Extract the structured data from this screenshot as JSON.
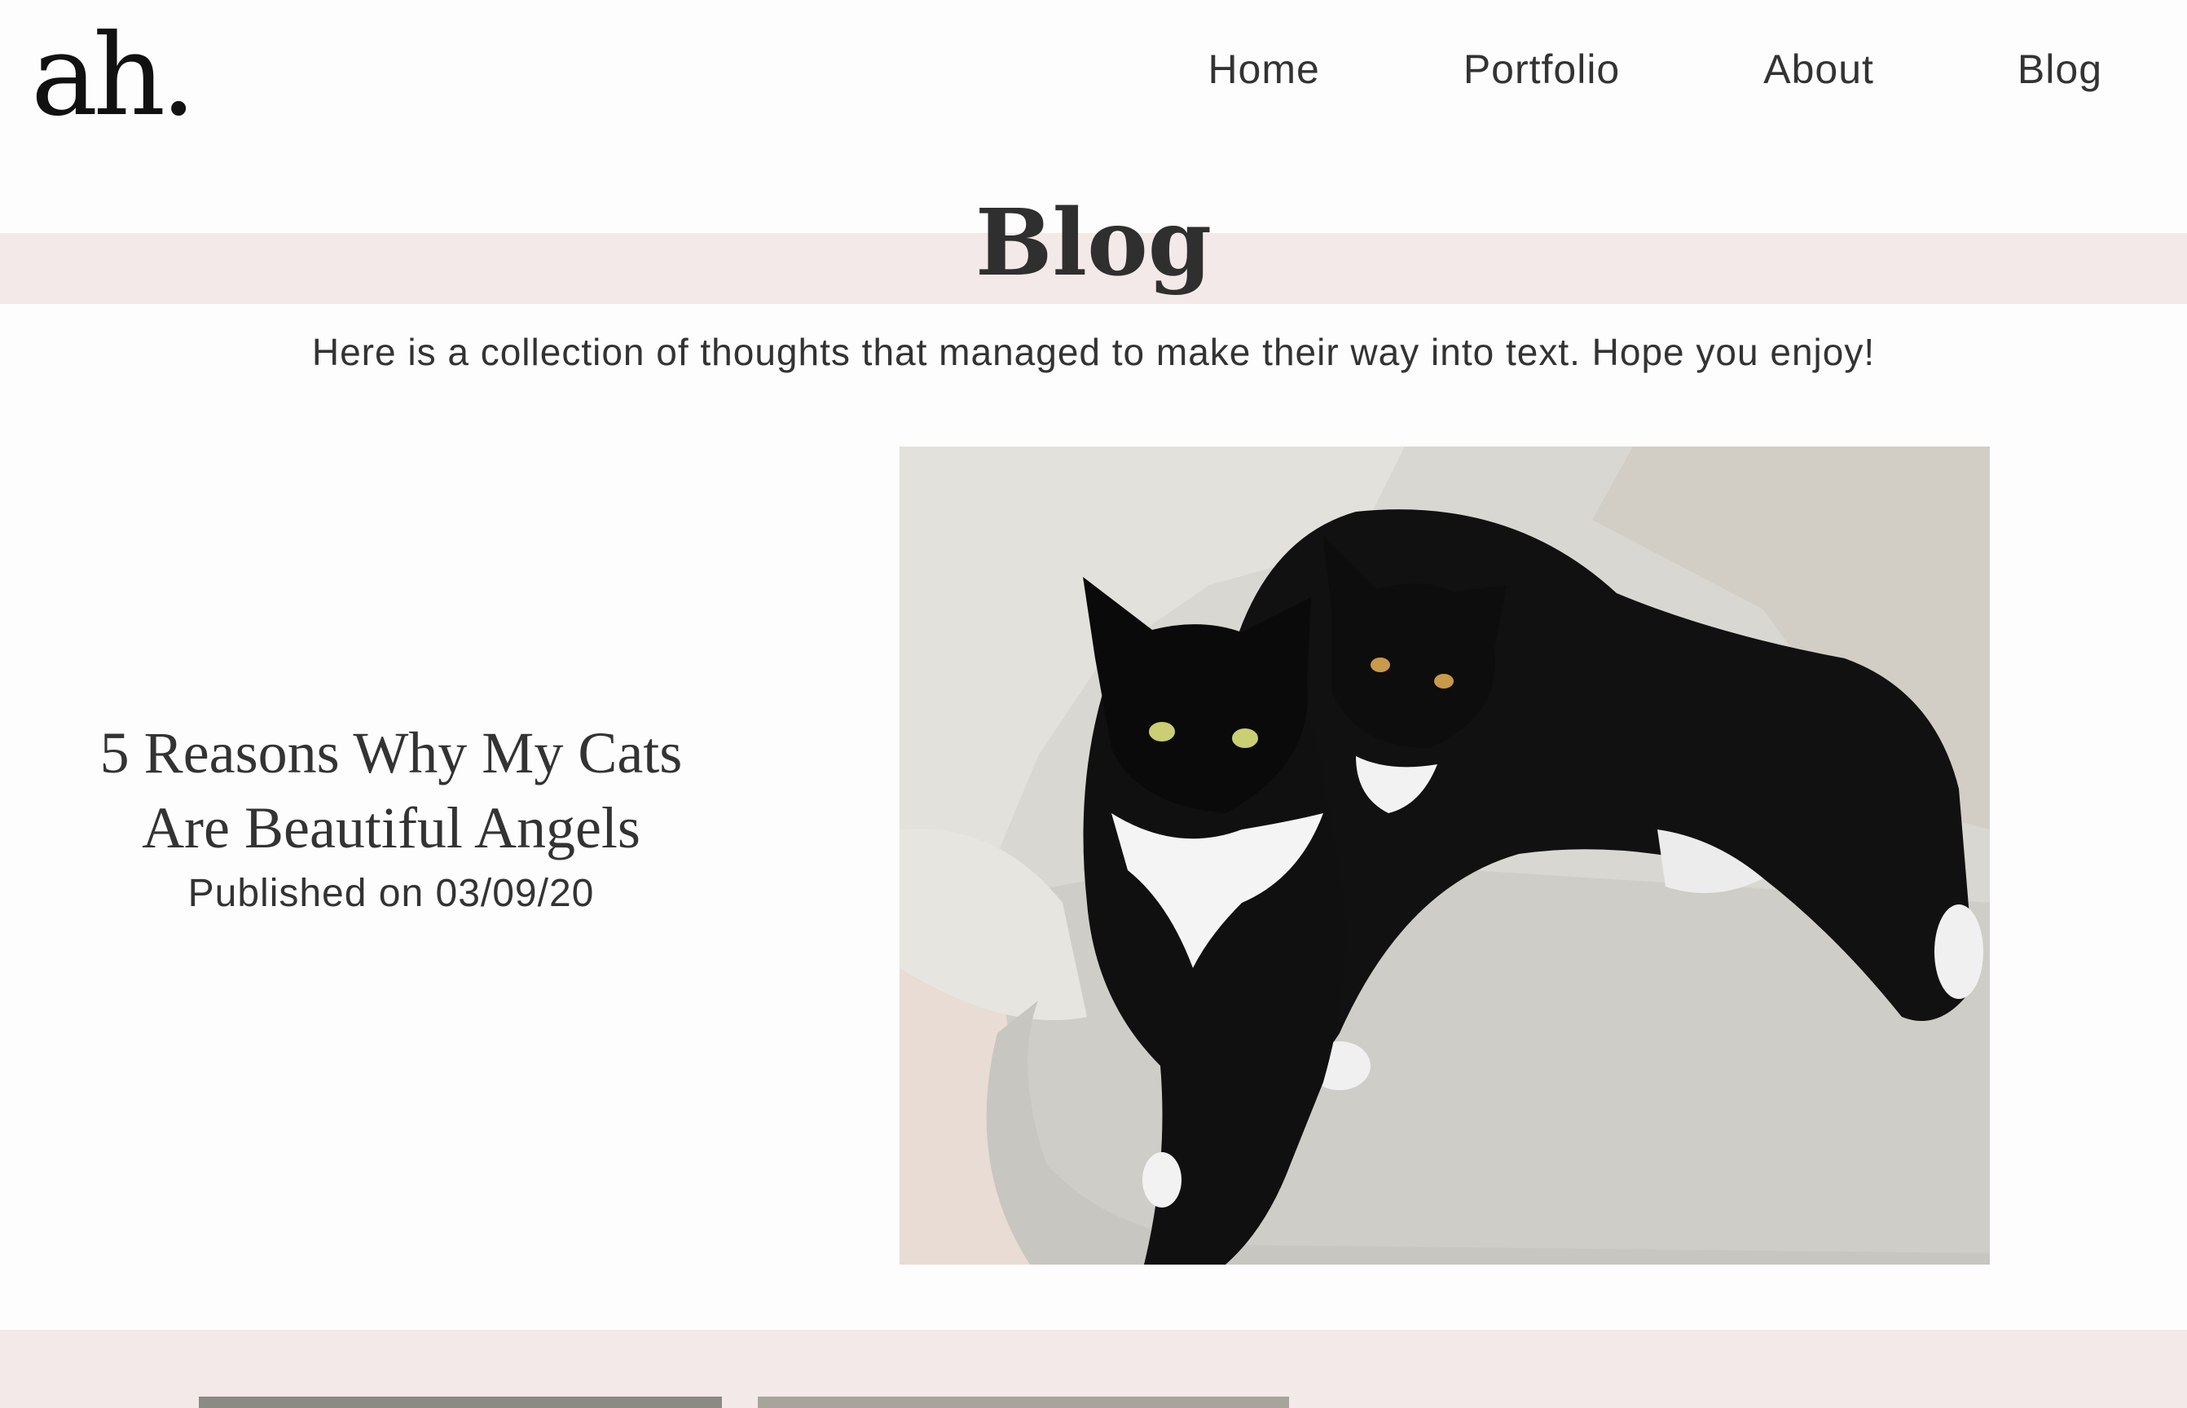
{
  "header": {
    "logo": "ah.",
    "nav": [
      "Home",
      "Portfolio",
      "About",
      "Blog"
    ]
  },
  "page": {
    "title": "Blog",
    "intro": "Here is a collection of thoughts that managed to make their way into text. Hope you enjoy!"
  },
  "posts": [
    {
      "title": "5 Reasons Why My Cats Are Beautiful Angels",
      "date": "Published on 03/09/20",
      "image_description": "Two black-and-white tuxedo cats lying on a light grey armchair"
    }
  ],
  "colors": {
    "band": "#f2e9e8",
    "text": "#333333",
    "background": "#fefdfd"
  }
}
